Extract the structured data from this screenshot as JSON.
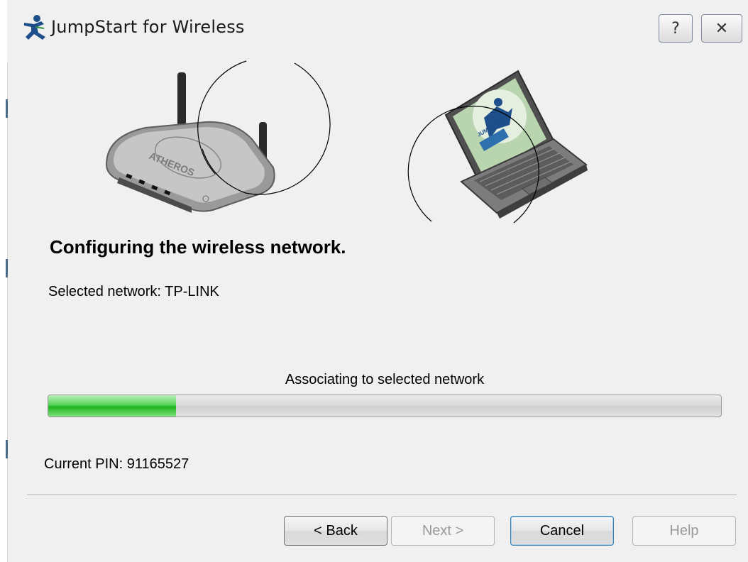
{
  "window": {
    "title": "JumpStart for Wireless",
    "help_glyph": "?",
    "close_glyph": "✕"
  },
  "icons": {
    "app": "jumpstart-runner-icon",
    "router": "wireless-router-image",
    "laptop": "laptop-image"
  },
  "router_brand": "ATHEROS",
  "laptop_logo": "JUMPSTART",
  "main": {
    "heading": "Configuring the wireless network.",
    "selected_network": "Selected network: TP-LINK",
    "status": "Associating to selected network",
    "progress_percent": 19,
    "pin": "Current PIN: 91165527"
  },
  "buttons": {
    "back": "< Back",
    "next": "Next >",
    "cancel": "Cancel",
    "help": "Help"
  },
  "colors": {
    "progress_green": "#1fb51f",
    "background": "#f0f0f0"
  }
}
